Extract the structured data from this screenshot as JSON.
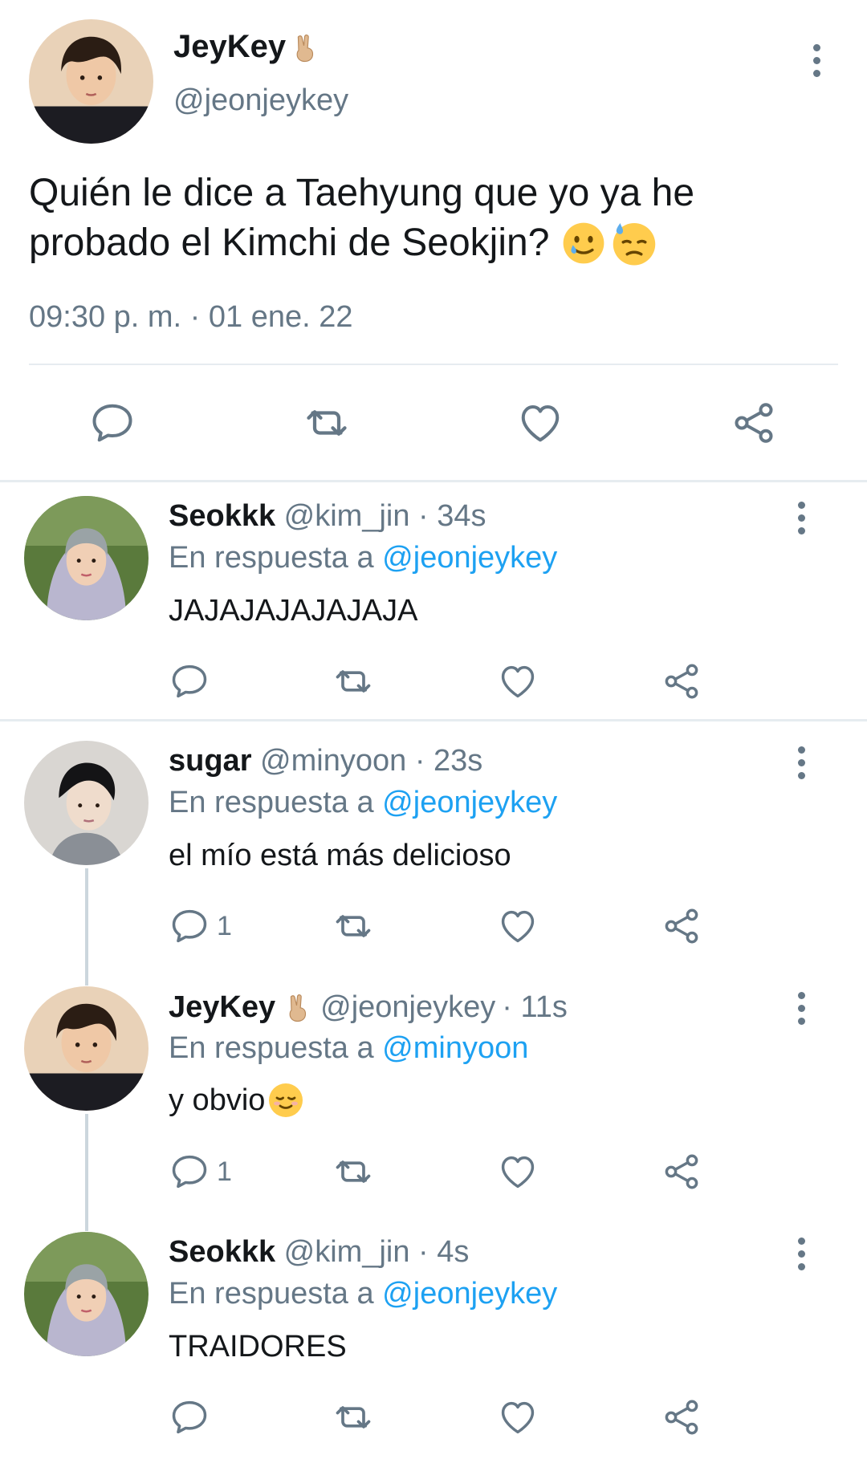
{
  "main_tweet": {
    "author_name": "JeyKey",
    "author_handle": "@jeonjeykey",
    "text_line1": "Quién le dice a Taehyung que yo ya he",
    "text_line2": "probado el Kimchi de Seokjin?",
    "timestamp": "09:30 p. m. · 01 ene. 22"
  },
  "replies": [
    {
      "author_name": "Seokkk",
      "author_handle": "@kim_jin",
      "time": "· 34s",
      "in_reply_prefix": "En respuesta a",
      "in_reply_handle": "@jeonjeykey",
      "text": "JAJAJAJAJAJAJA",
      "reply_count": ""
    },
    {
      "author_name": "sugar",
      "author_handle": "@minyoon",
      "time": "· 23s",
      "in_reply_prefix": "En respuesta a",
      "in_reply_handle": "@jeonjeykey",
      "text": "el mío está más delicioso",
      "reply_count": "1"
    },
    {
      "author_name": "JeyKey",
      "author_handle": "@jeonjeykey",
      "time": "· 11s",
      "in_reply_prefix": "En respuesta a",
      "in_reply_handle": "@minyoon",
      "text": "y obvio",
      "reply_count": "1"
    },
    {
      "author_name": "Seokkk",
      "author_handle": "@kim_jin",
      "time": "· 4s",
      "in_reply_prefix": "En respuesta a",
      "in_reply_handle": "@jeonjeykey",
      "text": "TRAIDORES",
      "reply_count": ""
    }
  ],
  "icons": {
    "reply": "speech-bubble-icon",
    "retweet": "retweet-icon",
    "like": "heart-icon",
    "share": "share-icon",
    "more": "kebab-icon"
  },
  "colors": {
    "link": "#1da1f2",
    "muted": "#657786",
    "text": "#14171a",
    "divider": "#e6ecf0"
  }
}
